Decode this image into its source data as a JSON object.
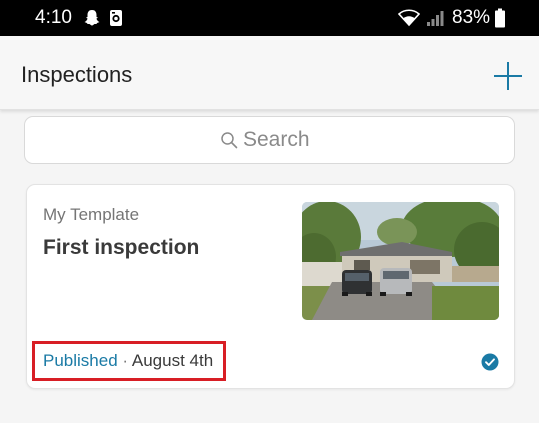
{
  "status_bar": {
    "time": "4:10",
    "battery": "83%",
    "icons": [
      "snapchat-ghost-icon",
      "camera-box-icon",
      "wifi-icon",
      "cellular-signal-icon",
      "battery-icon"
    ]
  },
  "header": {
    "title": "Inspections",
    "add_icon": "plus-icon",
    "accent_color": "#1a7aa5"
  },
  "search": {
    "placeholder": "Search",
    "icon": "search-icon"
  },
  "inspections": [
    {
      "template": "My Template",
      "title": "First inspection",
      "status": "Published",
      "separator": "·",
      "date": "August 4th",
      "status_color": "#1a7aa5",
      "completed": true,
      "photo": "house-with-cars-photo"
    }
  ],
  "highlight": {
    "color": "#d81e25",
    "target": "published-date"
  }
}
